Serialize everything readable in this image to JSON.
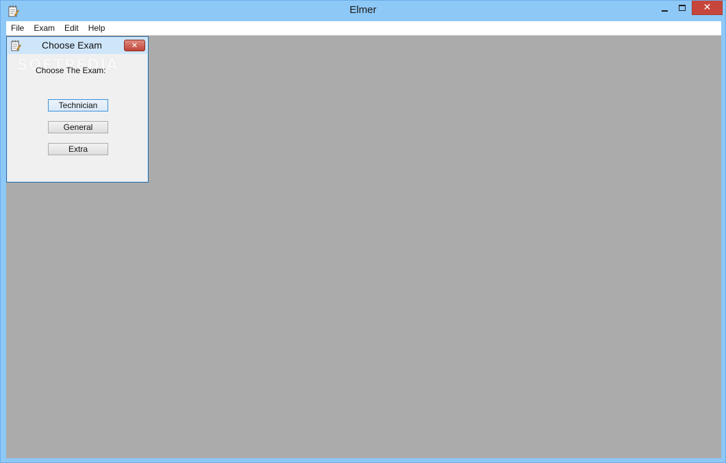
{
  "window": {
    "title": "Elmer",
    "app_icon": "notepad-icon",
    "controls": {
      "minimize_icon": "minimize-icon",
      "maximize_icon": "maximize-icon",
      "close_icon": "close-icon",
      "close_glyph": "✕"
    }
  },
  "menubar": {
    "items": [
      {
        "label": "File"
      },
      {
        "label": "Exam"
      },
      {
        "label": "Edit"
      },
      {
        "label": "Help"
      }
    ]
  },
  "dialog": {
    "title": "Choose Exam",
    "icon": "notepad-icon",
    "close_glyph": "✕",
    "prompt": "Choose The Exam:",
    "watermark": "SOFTPEDIA",
    "buttons": [
      {
        "label": "Technician",
        "focused": true
      },
      {
        "label": "General",
        "focused": false
      },
      {
        "label": "Extra",
        "focused": false
      }
    ]
  },
  "colors": {
    "titlebar": "#8ec8f6",
    "client_area": "#ababab",
    "close_button": "#c7463c",
    "dialog_frame": "#cfe6fa"
  }
}
